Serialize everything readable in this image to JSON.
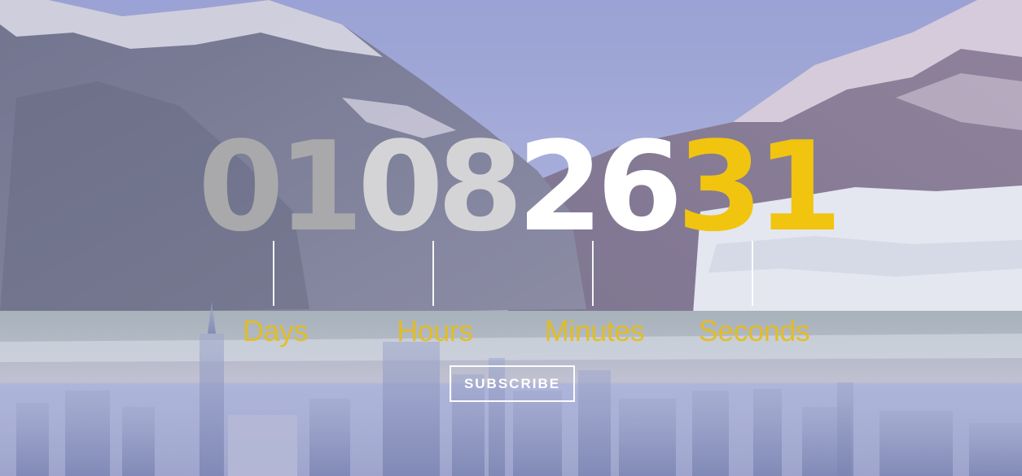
{
  "countdown": {
    "days": "01",
    "hours": "08",
    "minutes": "26",
    "seconds": "31",
    "labels": {
      "days": "Days",
      "hours": "Hours",
      "minutes": "Minutes",
      "seconds": "Seconds"
    }
  },
  "cta": {
    "subscribe_label": "SUBSCRIBE"
  },
  "colors": {
    "accent": "#f1c40f",
    "days_digits": "#a9a9ab",
    "hours_digits": "#d4d4d6",
    "minutes_digits": "#ffffff"
  }
}
